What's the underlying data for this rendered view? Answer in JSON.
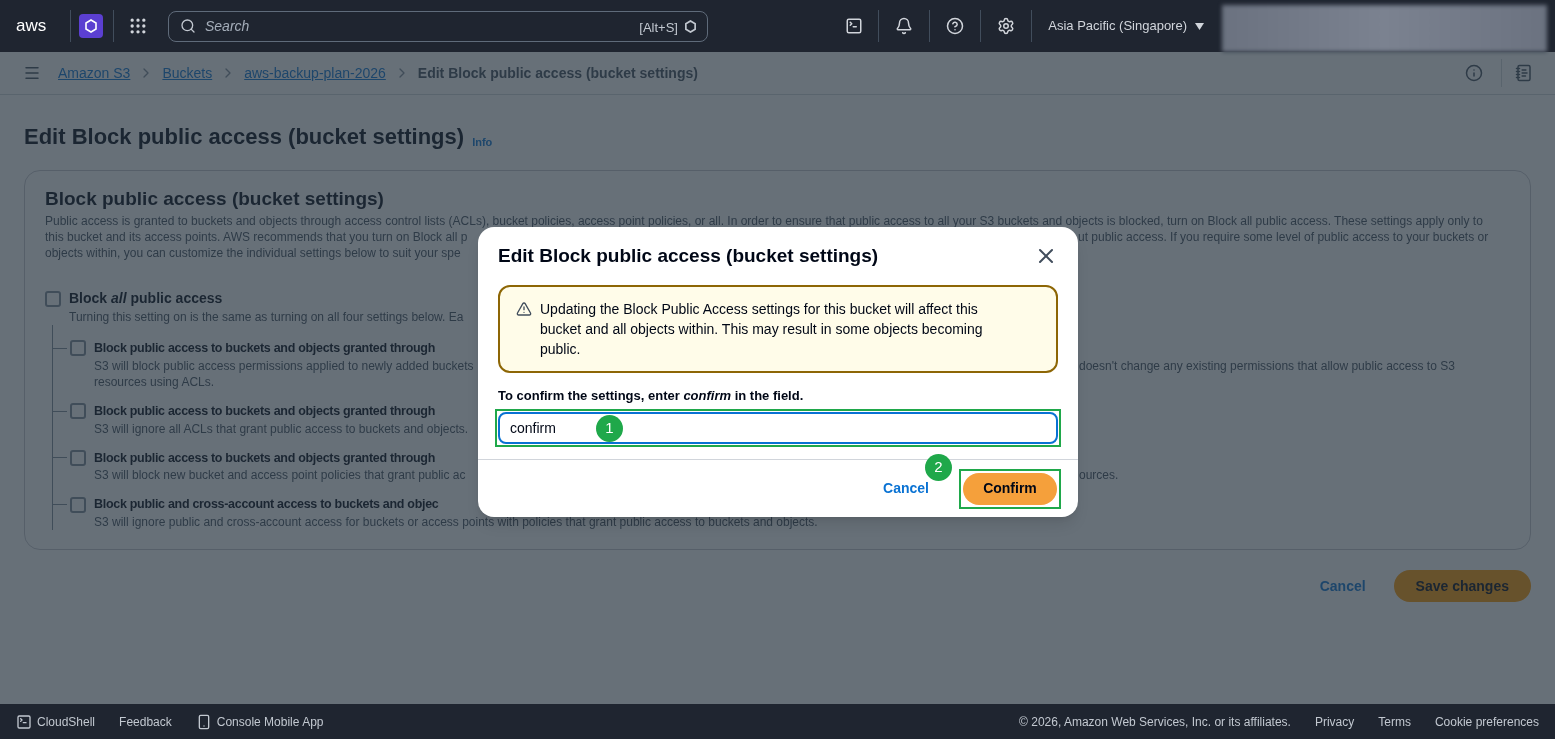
{
  "top_nav": {
    "logo": "aws",
    "search": {
      "placeholder": "Search",
      "shortcut": "[Alt+S]"
    },
    "region": "Asia Pacific (Singapore)"
  },
  "breadcrumbs": [
    {
      "label": "Amazon S3",
      "kind": "link"
    },
    {
      "label": "Buckets",
      "kind": "link"
    },
    {
      "label": "aws-backup-plan-2026",
      "kind": "link"
    },
    {
      "label": "Edit Block public access (bucket settings)",
      "kind": "current"
    }
  ],
  "page": {
    "title": "Edit Block public access (bucket settings)",
    "info_link": "Info"
  },
  "panel": {
    "title": "Block public access (bucket settings)",
    "description_lines": [
      {
        "left": "Public access is granted to buckets and objects through access control lists (ACLs), bucket policies, access point policies, or all. In order to ensure that public access to all your S3 buckets and objects is blocked, turn on Block all public access. These settings apply only to"
      },
      {
        "left": "this bucket and its access points. AWS recommends that you turn on Block all p",
        "right": "ut public access. If you require some level of public access to your buckets or"
      },
      {
        "left": "objects within, you can customize the individual settings below to suit your spe"
      }
    ],
    "master": {
      "label": "Block *all* public access",
      "checked": false,
      "lines": [
        {
          "left": "Turning this setting on is the same as turning on all four settings below. Ea"
        }
      ]
    },
    "settings": [
      {
        "label": "Block public access to buckets and objects granted through",
        "checked": false,
        "lines": [
          {
            "left": "S3 will block public access permissions applied to newly added buckets",
            "right": "doesn't change any existing permissions that allow public access to S3"
          },
          {
            "left": "resources using ACLs."
          }
        ]
      },
      {
        "label": "Block public access to buckets and objects granted through",
        "checked": false,
        "lines": [
          {
            "left": "S3 will ignore all ACLs that grant public access to buckets and objects."
          }
        ]
      },
      {
        "label": "Block public access to buckets and objects granted through",
        "checked": false,
        "lines": [
          {
            "left": "S3 will block new bucket and access point policies that grant public ac",
            "right": "ources."
          }
        ]
      },
      {
        "label": "Block public and cross-account access to buckets and objec",
        "checked": false,
        "lines": [
          {
            "left": "S3 will ignore public and cross-account access for buckets or access points with policies that grant public access to buckets and objects."
          }
        ]
      }
    ]
  },
  "actions": {
    "cancel": "Cancel",
    "save": "Save changes"
  },
  "footer": {
    "left": [
      "CloudShell",
      "Feedback",
      "Console Mobile App"
    ],
    "copyright": "© 2026, Amazon Web Services, Inc. or its affiliates.",
    "links": [
      "Privacy",
      "Terms",
      "Cookie preferences"
    ]
  },
  "modal": {
    "title": "Edit Block public access (bucket settings)",
    "alert": "Updating the Block Public Access settings for this bucket will affect this bucket and all objects within. This may result in some objects becoming public.",
    "label": "To confirm the settings, enter *confirm* in the field.",
    "value": "confirm",
    "cancel": "Cancel",
    "confirm": "Confirm",
    "steps": [
      "1",
      "2"
    ]
  }
}
